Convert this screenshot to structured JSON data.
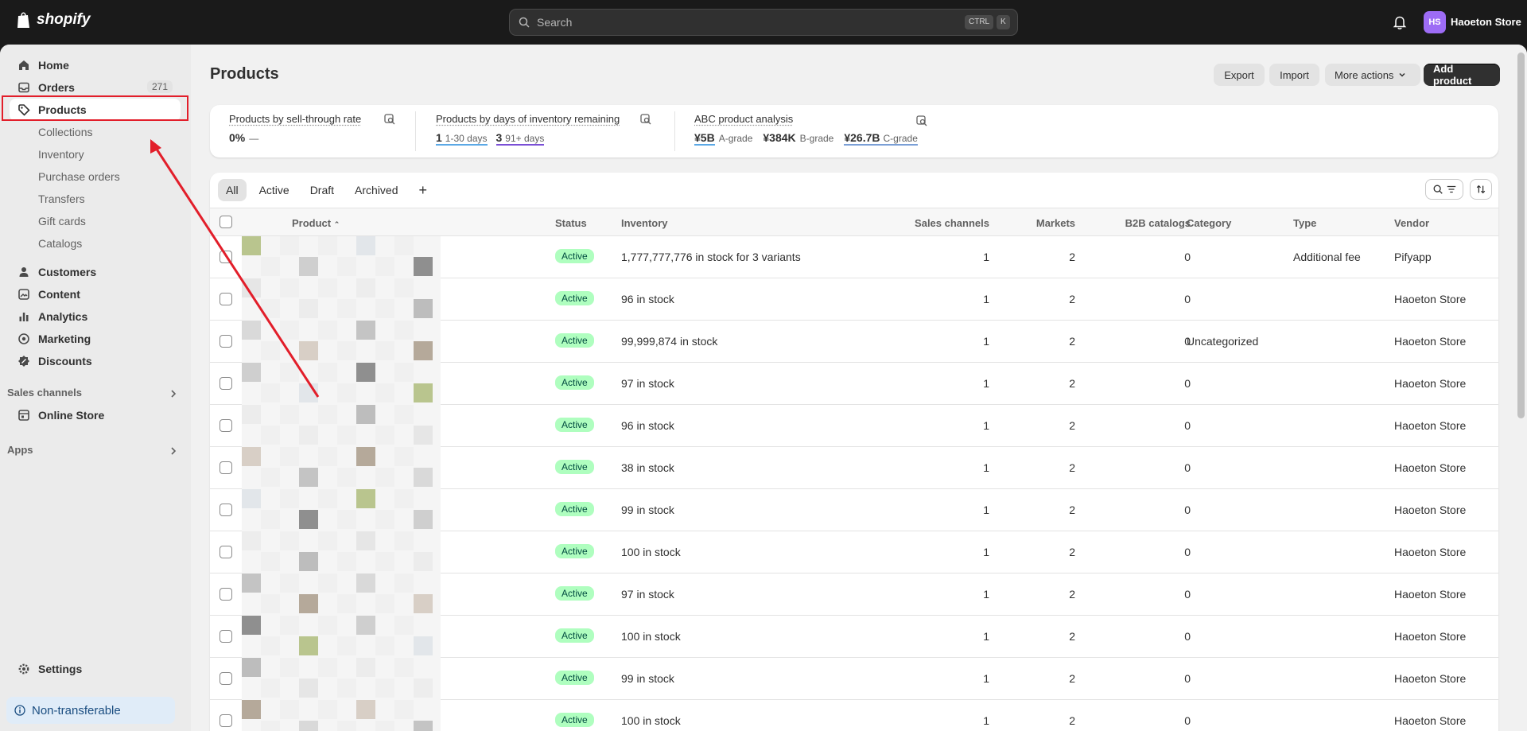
{
  "topbar": {
    "brand": "shopify",
    "search_placeholder": "Search",
    "kbd1": "CTRL",
    "kbd2": "K",
    "avatar_initials": "HS",
    "store_name": "Haoeton Store"
  },
  "sidebar": {
    "home": "Home",
    "orders": "Orders",
    "orders_count": "271",
    "products": "Products",
    "subs": [
      "Collections",
      "Inventory",
      "Purchase orders",
      "Transfers",
      "Gift cards",
      "Catalogs"
    ],
    "customers": "Customers",
    "content": "Content",
    "analytics": "Analytics",
    "marketing": "Marketing",
    "discounts": "Discounts",
    "sales_channels": "Sales channels",
    "online_store": "Online Store",
    "apps": "Apps",
    "settings": "Settings",
    "non_transferable": "Non-transferable"
  },
  "page": {
    "title": "Products",
    "export": "Export",
    "import": "Import",
    "more_actions": "More actions",
    "add_product": "Add product"
  },
  "analytics": {
    "sell_through": {
      "title": "Products by sell-through rate",
      "value": "0%",
      "dash": "—"
    },
    "days_inventory": {
      "title": "Products by days of inventory remaining",
      "v1": "1",
      "l1": "1-30 days",
      "v2": "3",
      "l2": "91+ days"
    },
    "abc": {
      "title": "ABC product analysis",
      "a": "¥5B",
      "a_label": "A-grade",
      "b": "¥384K",
      "b_label": "B-grade",
      "c": "¥26.7B",
      "c_label": "C-grade"
    }
  },
  "tabs": [
    "All",
    "Active",
    "Draft",
    "Archived",
    "+"
  ],
  "columns": {
    "product": "Product",
    "status": "Status",
    "inventory": "Inventory",
    "sales_channels": "Sales channels",
    "markets": "Markets",
    "b2b": "B2B catalogs",
    "category": "Category",
    "type": "Type",
    "vendor": "Vendor"
  },
  "rows": [
    {
      "status": "Active",
      "inventory": "1,777,777,776 in stock for 3 variants",
      "sales": "1",
      "markets": "2",
      "b2b": "0",
      "category": "",
      "type": "Additional fee",
      "vendor": "Pifyapp"
    },
    {
      "status": "Active",
      "inventory": "96 in stock",
      "sales": "1",
      "markets": "2",
      "b2b": "0",
      "category": "",
      "type": "",
      "vendor": "Haoeton Store"
    },
    {
      "status": "Active",
      "inventory": "99,999,874 in stock",
      "sales": "1",
      "markets": "2",
      "b2b": "0",
      "category": "Uncategorized",
      "type": "",
      "vendor": "Haoeton Store"
    },
    {
      "status": "Active",
      "inventory": "97 in stock",
      "sales": "1",
      "markets": "2",
      "b2b": "0",
      "category": "",
      "type": "",
      "vendor": "Haoeton Store"
    },
    {
      "status": "Active",
      "inventory": "96 in stock",
      "sales": "1",
      "markets": "2",
      "b2b": "0",
      "category": "",
      "type": "",
      "vendor": "Haoeton Store"
    },
    {
      "status": "Active",
      "inventory": "38 in stock",
      "sales": "1",
      "markets": "2",
      "b2b": "0",
      "category": "",
      "type": "",
      "vendor": "Haoeton Store"
    },
    {
      "status": "Active",
      "inventory": "99 in stock",
      "sales": "1",
      "markets": "2",
      "b2b": "0",
      "category": "",
      "type": "",
      "vendor": "Haoeton Store"
    },
    {
      "status": "Active",
      "inventory": "100 in stock",
      "sales": "1",
      "markets": "2",
      "b2b": "0",
      "category": "",
      "type": "",
      "vendor": "Haoeton Store"
    },
    {
      "status": "Active",
      "inventory": "97 in stock",
      "sales": "1",
      "markets": "2",
      "b2b": "0",
      "category": "",
      "type": "",
      "vendor": "Haoeton Store"
    },
    {
      "status": "Active",
      "inventory": "100 in stock",
      "sales": "1",
      "markets": "2",
      "b2b": "0",
      "category": "",
      "type": "",
      "vendor": "Haoeton Store"
    },
    {
      "status": "Active",
      "inventory": "99 in stock",
      "sales": "1",
      "markets": "2",
      "b2b": "0",
      "category": "",
      "type": "",
      "vendor": "Haoeton Store"
    },
    {
      "status": "Active",
      "inventory": "100 in stock",
      "sales": "1",
      "markets": "2",
      "b2b": "0",
      "category": "",
      "type": "",
      "vendor": "Haoeton Store"
    }
  ],
  "colors": {
    "annotation": "#e21e2a",
    "status_bg": "#affebf",
    "accent": "#9d6cf5"
  }
}
